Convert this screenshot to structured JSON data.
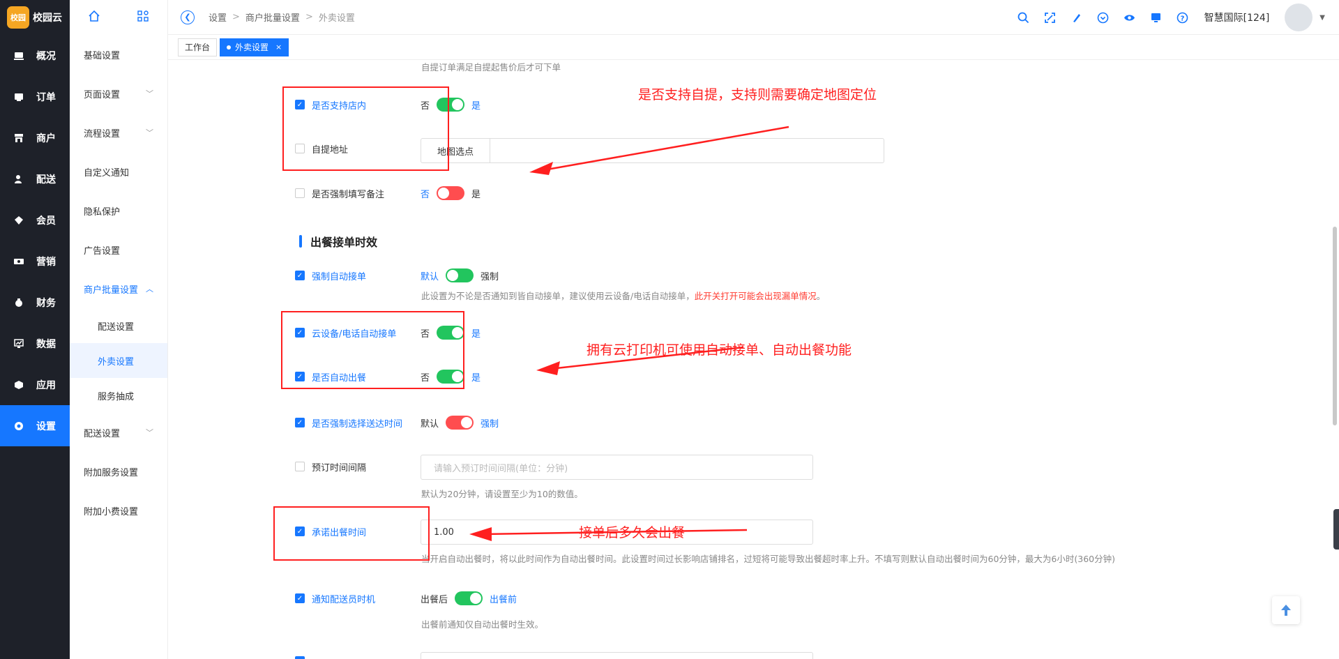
{
  "brand": {
    "logo_badge": "校园",
    "name": "校园云"
  },
  "leftnav": [
    {
      "icon": "overview-icon",
      "label": "概况"
    },
    {
      "icon": "order-icon",
      "label": "订单"
    },
    {
      "icon": "shop-icon",
      "label": "商户"
    },
    {
      "icon": "delivery-icon",
      "label": "配送"
    },
    {
      "icon": "member-icon",
      "label": "会员"
    },
    {
      "icon": "marketing-icon",
      "label": "营销"
    },
    {
      "icon": "finance-icon",
      "label": "财务"
    },
    {
      "icon": "data-icon",
      "label": "数据"
    },
    {
      "icon": "app-icon",
      "label": "应用"
    },
    {
      "icon": "settings-icon",
      "label": "设置",
      "active": true
    }
  ],
  "submenu": {
    "items": [
      {
        "label": "基础设置"
      },
      {
        "label": "页面设置",
        "chevron": "﹀"
      },
      {
        "label": "流程设置",
        "chevron": "﹀"
      },
      {
        "label": "自定义通知"
      },
      {
        "label": "隐私保护"
      },
      {
        "label": "广告设置"
      },
      {
        "label": "商户批量设置",
        "chevron": "︿"
      },
      {
        "label": "配送设置"
      },
      {
        "label": "外卖设置"
      },
      {
        "label": "服务抽成"
      },
      {
        "label": "配送设置",
        "chevron": "﹀"
      },
      {
        "label": "附加服务设置"
      },
      {
        "label": "附加小费设置"
      }
    ]
  },
  "header": {
    "breadcrumb": [
      "设置",
      "商户批量设置",
      "外卖设置"
    ],
    "username": "智慧国际[124]"
  },
  "tabs": [
    {
      "label": "工作台"
    },
    {
      "label": "外卖设置",
      "close": "×"
    }
  ],
  "form": {
    "top_helper": "自提订单满足自提起售价后才可下单",
    "support_instore": {
      "label": "是否支持店内",
      "off": "否",
      "on": "是"
    },
    "pickup_address": {
      "label": "自提地址",
      "button": "地图选点"
    },
    "force_remark": {
      "label": "是否强制填写备注",
      "off": "否",
      "on": "是"
    },
    "section_title": "出餐接单时效",
    "force_auto_accept": {
      "label": "强制自动接单",
      "off": "默认",
      "on": "强制"
    },
    "force_auto_accept_help": "此设置为不论是否通知到皆自动接单，建议使用云设备/电话自动接单，",
    "force_auto_accept_warn": "此开关打开可能会出现漏单情况",
    "force_auto_accept_end": "。",
    "cloud_auto_accept": {
      "label": "云设备/电话自动接单",
      "off": "否",
      "on": "是"
    },
    "auto_meal": {
      "label": "是否自动出餐",
      "off": "否",
      "on": "是"
    },
    "force_delivery_time": {
      "label": "是否强制选择送达时间",
      "off": "默认",
      "on": "强制"
    },
    "reserve_interval": {
      "label": "预订时间间隔",
      "placeholder": "请输入预订时间间隔(单位：分钟)"
    },
    "reserve_interval_help": "默认为20分钟，请设置至少为10的数值。",
    "promise_time": {
      "label": "承诺出餐时间",
      "value": "1.00"
    },
    "promise_time_help": "当开启自动出餐时，将以此时间作为自动出餐时间。此设置时间过长影响店铺排名，过短将可能导致出餐超时率上升。不填写则默认自动出餐时间为60分钟，最大为6小时(360分钟)",
    "notify_rider": {
      "label": "通知配送员时机",
      "off": "出餐后",
      "on": "出餐前"
    },
    "notify_rider_help": "出餐前通知仅自动出餐时生效。"
  },
  "annotations": {
    "note1": "是否支持自提，支持则需要确定地图定位",
    "note2": "拥有云打印机可使用自动接单、自动出餐功能",
    "note3": "接单后多久会出餐"
  },
  "colors": {
    "primary": "#1677ff",
    "nav_bg": "#1e2129",
    "switch_on": "#22c55e",
    "switch_red": "#ff4d4f",
    "annotation": "#ff1f1f"
  }
}
